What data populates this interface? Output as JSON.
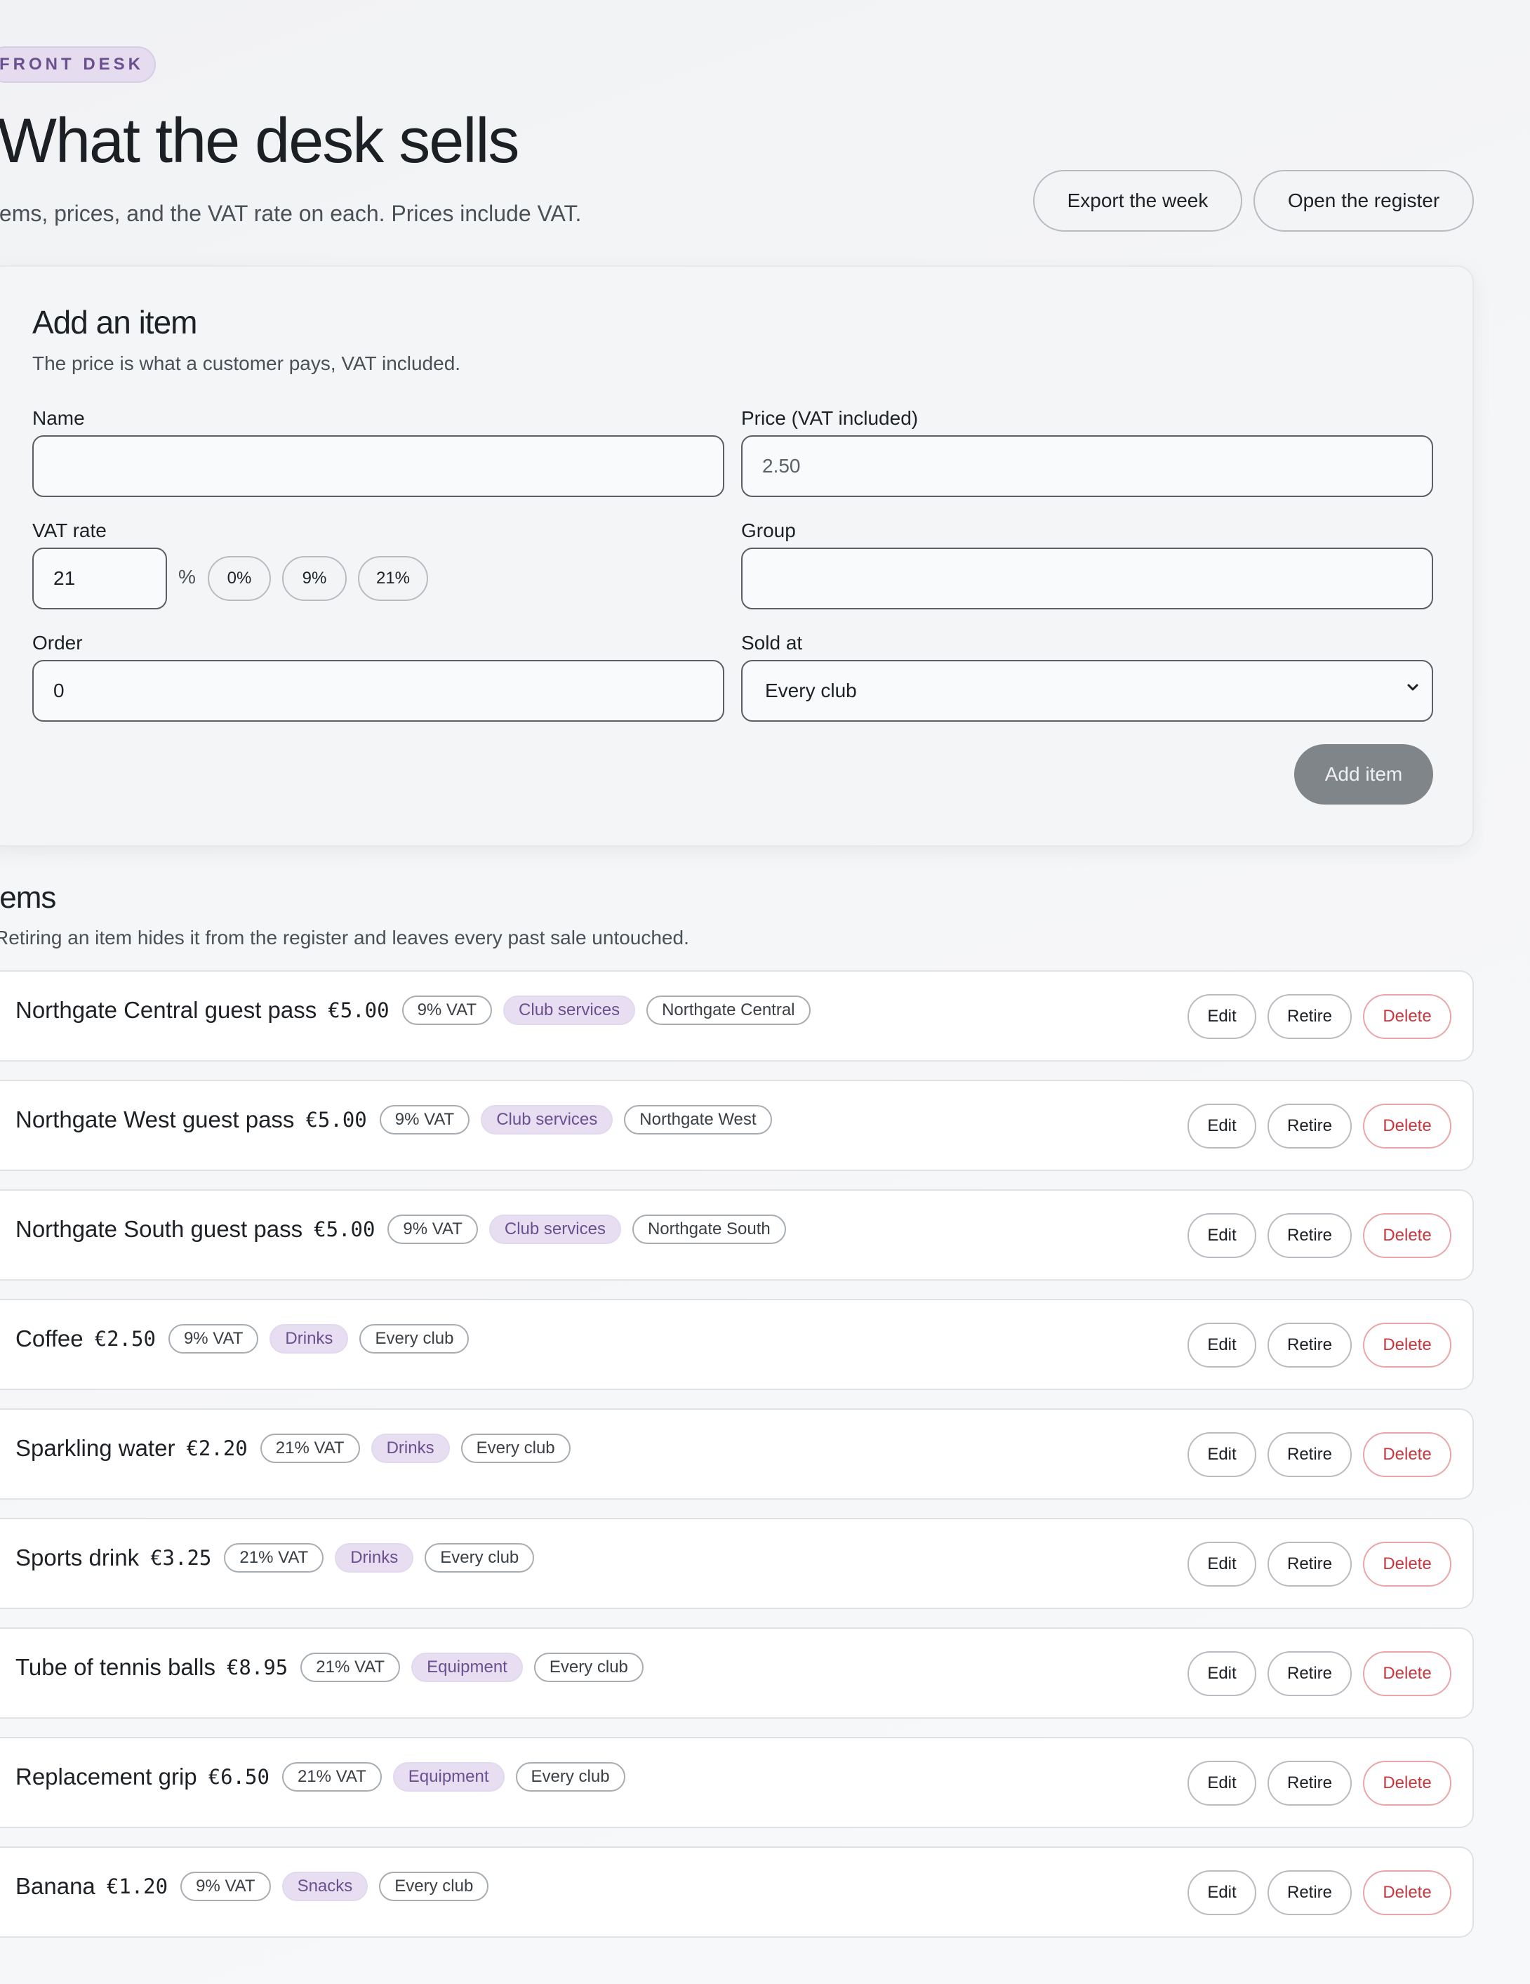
{
  "header": {
    "eyebrow": "FRONT DESK",
    "title": "What the desk sells",
    "subtitle": "tems, prices, and the VAT rate on each. Prices include VAT.",
    "export_label": "Export the week",
    "register_label": "Open the register"
  },
  "form": {
    "title": "Add an item",
    "subtitle": "The price is what a customer pays, VAT included.",
    "name_label": "Name",
    "name_value": "",
    "price_label": "Price (VAT included)",
    "price_placeholder": "2.50",
    "vat_label": "VAT rate",
    "vat_value": "21",
    "vat_unit": "%",
    "vat_presets": [
      "0%",
      "9%",
      "21%"
    ],
    "group_label": "Group",
    "group_value": "",
    "order_label": "Order",
    "order_value": "0",
    "sold_at_label": "Sold at",
    "sold_at_value": "Every club",
    "submit_label": "Add item"
  },
  "items_section": {
    "title": "tems",
    "subtitle": "Retiring an item hides it from the register and leaves every past sale untouched.",
    "edit_label": "Edit",
    "retire_label": "Retire",
    "delete_label": "Delete"
  },
  "items": [
    {
      "name": "Northgate Central guest pass",
      "price": "€5.00",
      "vat": "9% VAT",
      "group": "Club services",
      "club": "Northgate Central"
    },
    {
      "name": "Northgate West guest pass",
      "price": "€5.00",
      "vat": "9% VAT",
      "group": "Club services",
      "club": "Northgate West"
    },
    {
      "name": "Northgate South guest pass",
      "price": "€5.00",
      "vat": "9% VAT",
      "group": "Club services",
      "club": "Northgate South"
    },
    {
      "name": "Coffee",
      "price": "€2.50",
      "vat": "9% VAT",
      "group": "Drinks",
      "club": "Every club"
    },
    {
      "name": "Sparkling water",
      "price": "€2.20",
      "vat": "21% VAT",
      "group": "Drinks",
      "club": "Every club"
    },
    {
      "name": "Sports drink",
      "price": "€3.25",
      "vat": "21% VAT",
      "group": "Drinks",
      "club": "Every club"
    },
    {
      "name": "Tube of tennis balls",
      "price": "€8.95",
      "vat": "21% VAT",
      "group": "Equipment",
      "club": "Every club"
    },
    {
      "name": "Replacement grip",
      "price": "€6.50",
      "vat": "21% VAT",
      "group": "Equipment",
      "club": "Every club"
    },
    {
      "name": "Banana",
      "price": "€1.20",
      "vat": "9% VAT",
      "group": "Snacks",
      "club": "Every club"
    }
  ],
  "colors": {
    "accent": "#6b4f8f",
    "accent_bg": "#e8def1",
    "danger": "#c9363d",
    "button_disabled": "#80858a"
  }
}
